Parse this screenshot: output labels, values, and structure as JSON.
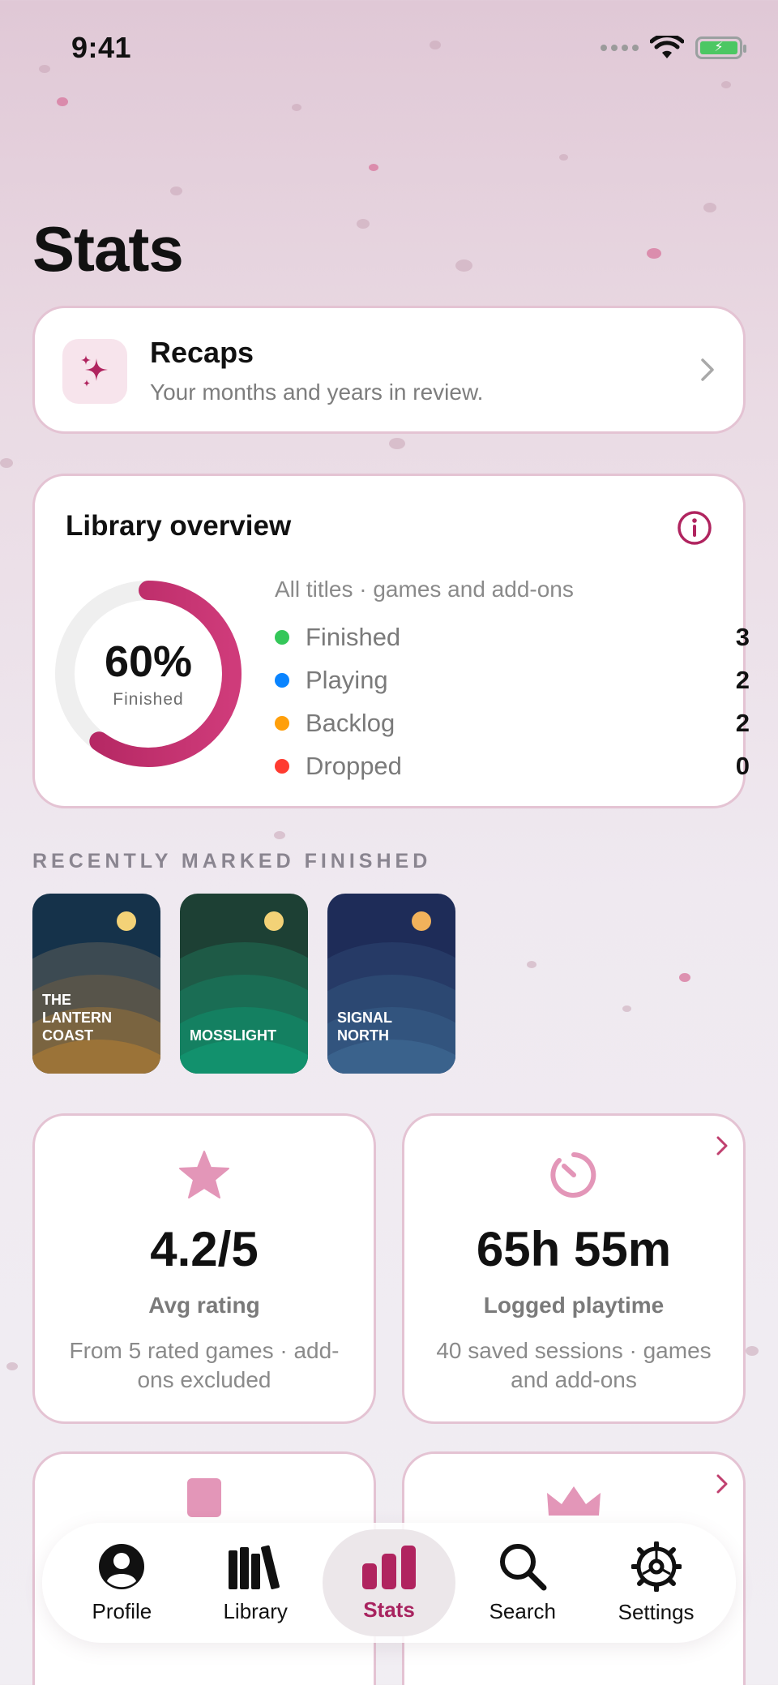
{
  "status": {
    "time": "9:41"
  },
  "page": {
    "title": "Stats"
  },
  "recaps": {
    "title": "Recaps",
    "subtitle": "Your months and years in review."
  },
  "overview": {
    "title": "Library overview",
    "percent": "60%",
    "percent_label": "Finished",
    "progress_fraction": 0.6,
    "caption": "All titles · games and add-ons",
    "legend": [
      {
        "name": "Finished",
        "value": "3",
        "color": "#34c759"
      },
      {
        "name": "Playing",
        "value": "2",
        "color": "#0a84ff"
      },
      {
        "name": "Backlog",
        "value": "2",
        "color": "#ff9f0a"
      },
      {
        "name": "Dropped",
        "value": "0",
        "color": "#ff3b30"
      }
    ]
  },
  "recent": {
    "label": "RECENTLY MARKED FINISHED",
    "covers": [
      {
        "title_lines": [
          "THE",
          "LANTERN",
          "COAST"
        ]
      },
      {
        "title_lines": [
          "MOSSLIGHT"
        ]
      },
      {
        "title_lines": [
          "SIGNAL",
          "NORTH"
        ]
      }
    ]
  },
  "stats": {
    "rating": {
      "value": "4.2/5",
      "label": "Avg rating",
      "desc": "From 5 rated games · add-ons excluded"
    },
    "playtime": {
      "value": "65h 55m",
      "label": "Logged playtime",
      "desc": "40 saved sessions · games and add-ons"
    }
  },
  "tabbar": {
    "items": [
      {
        "label": "Profile",
        "icon": "person-icon"
      },
      {
        "label": "Library",
        "icon": "books-icon"
      },
      {
        "label": "Stats",
        "icon": "bar-chart-icon",
        "active": true
      },
      {
        "label": "Search",
        "icon": "search-icon"
      },
      {
        "label": "Settings",
        "icon": "gear-icon"
      }
    ]
  },
  "colors": {
    "accent": "#b0245f",
    "accent_light": "#e396b8"
  }
}
